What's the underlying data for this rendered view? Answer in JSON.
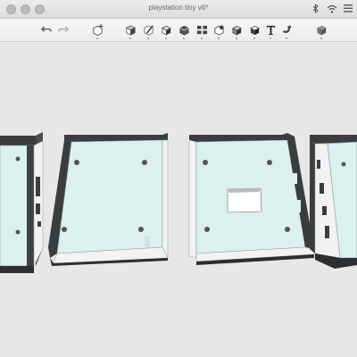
{
  "window": {
    "title": "playstation tiny v6*"
  },
  "toolbar": {
    "tools": [
      {
        "name": "undo-icon"
      },
      {
        "name": "redo-icon"
      },
      {
        "name": "add-sketch-icon"
      },
      {
        "name": "box-primitive-icon"
      },
      {
        "name": "sketch-pencil-icon"
      },
      {
        "name": "extrude-icon"
      },
      {
        "name": "revolve-icon"
      },
      {
        "name": "pattern-icon"
      },
      {
        "name": "shell-icon"
      },
      {
        "name": "combine-icon"
      },
      {
        "name": "measure-icon"
      },
      {
        "name": "text-icon"
      },
      {
        "name": "magnet-icon"
      },
      {
        "name": "material-icon"
      }
    ]
  },
  "colors": {
    "plate": "#dcf0f0",
    "wall_dark": "#3a3d3e",
    "wall_light": "#f2f2f2",
    "background": "#e7e7e7"
  }
}
